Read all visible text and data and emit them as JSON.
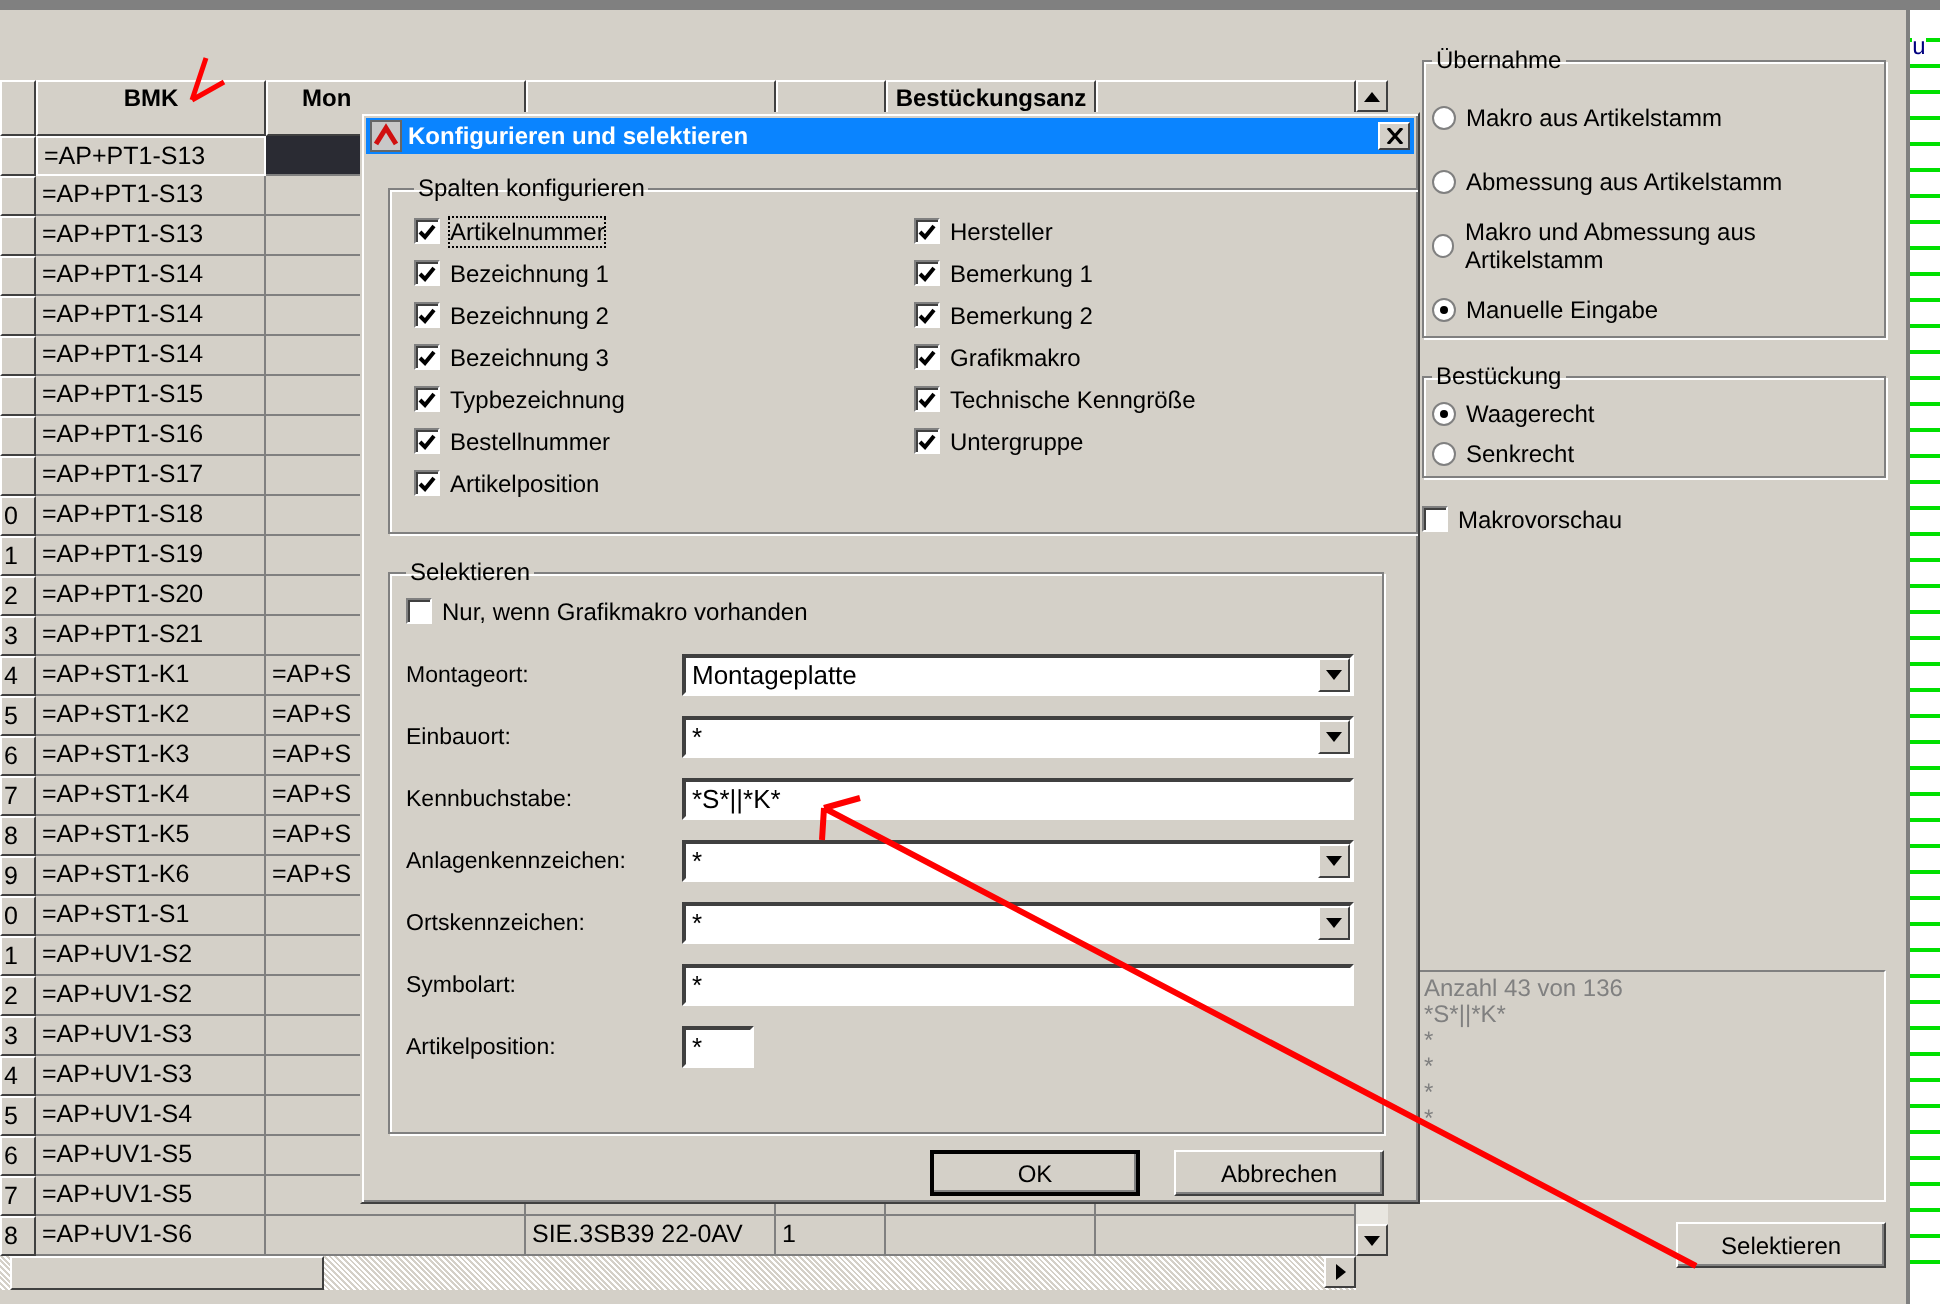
{
  "table": {
    "header": {
      "column_2": "BMK",
      "column_3": "Mon",
      "column_6": "Bestückungsanz"
    },
    "rows": [
      {
        "column_2": "=AP+PT1-S13",
        "selected": true
      },
      {
        "column_2": "=AP+PT1-S13",
        "selected": false
      },
      {
        "column_2": "=AP+PT1-S13",
        "selected": false
      },
      {
        "column_2": "=AP+PT1-S14",
        "selected": false
      },
      {
        "column_2": "=AP+PT1-S14",
        "selected": false
      },
      {
        "column_2": "=AP+PT1-S14",
        "selected": false
      },
      {
        "column_2": "=AP+PT1-S15",
        "selected": false
      },
      {
        "column_2": "=AP+PT1-S16",
        "selected": false
      },
      {
        "column_2": "=AP+PT1-S17",
        "selected": false
      },
      {
        "column_1": "0",
        "column_2": "=AP+PT1-S18",
        "selected": false
      },
      {
        "column_1": "1",
        "column_2": "=AP+PT1-S19",
        "selected": false
      },
      {
        "column_1": "2",
        "column_2": "=AP+PT1-S20",
        "selected": false
      },
      {
        "column_1": "3",
        "column_2": "=AP+PT1-S21",
        "selected": false
      },
      {
        "column_1": "4",
        "column_2": "=AP+ST1-K1",
        "column_3": "=AP+S",
        "selected": false
      },
      {
        "column_1": "5",
        "column_2": "=AP+ST1-K2",
        "column_3": "=AP+S",
        "selected": false
      },
      {
        "column_1": "6",
        "column_2": "=AP+ST1-K3",
        "column_3": "=AP+S",
        "selected": false
      },
      {
        "column_1": "7",
        "column_2": "=AP+ST1-K4",
        "column_3": "=AP+S",
        "selected": false
      },
      {
        "column_1": "8",
        "column_2": "=AP+ST1-K5",
        "column_3": "=AP+S",
        "selected": false
      },
      {
        "column_1": "9",
        "column_2": "=AP+ST1-K6",
        "column_3": "=AP+S",
        "selected": false
      },
      {
        "column_1": "0",
        "column_2": "=AP+ST1-S1",
        "selected": false
      },
      {
        "column_1": "1",
        "column_2": "=AP+UV1-S2",
        "selected": false
      },
      {
        "column_1": "2",
        "column_2": "=AP+UV1-S2",
        "selected": false
      },
      {
        "column_1": "3",
        "column_2": "=AP+UV1-S3",
        "selected": false
      },
      {
        "column_1": "4",
        "column_2": "=AP+UV1-S3",
        "selected": false
      },
      {
        "column_1": "5",
        "column_2": "=AP+UV1-S4",
        "selected": false
      },
      {
        "column_1": "6",
        "column_2": "=AP+UV1-S5",
        "selected": false
      },
      {
        "column_1": "7",
        "column_2": "=AP+UV1-S5",
        "selected": false
      },
      {
        "column_1": "8",
        "column_2": "=AP+UV1-S6",
        "column_4": "SIE.3SB39 22-0AV",
        "column_5": "1",
        "selected": false
      }
    ]
  },
  "side_panel": {
    "uebernahme": {
      "title": "Übernahme",
      "options": [
        {
          "label": "Makro aus Artikelstamm",
          "selected": false
        },
        {
          "label": "Abmessung aus Artikelstamm",
          "selected": false
        },
        {
          "label": "Makro und Abmessung aus Artikelstamm",
          "selected": false
        },
        {
          "label": "Manuelle Eingabe",
          "selected": true
        }
      ]
    },
    "bestueckung": {
      "title": "Bestückung",
      "options": [
        {
          "label": "Waagerecht",
          "selected": true
        },
        {
          "label": "Senkrecht",
          "selected": false
        }
      ]
    },
    "preview": {
      "label": "Makrovorschau",
      "checked": false
    },
    "info_lines": [
      "Anzahl 43 von 136",
      "*S*||*K*",
      "*",
      "*",
      "*",
      "*"
    ],
    "select_button": "Selektieren"
  },
  "right_edge_text": "u",
  "dialog": {
    "title": "Konfigurieren und selektieren",
    "columns_group": {
      "title": "Spalten konfigurieren",
      "items": [
        {
          "label": "Artikelnummer",
          "checked": true,
          "focused": true
        },
        {
          "label": "Bezeichnung 1",
          "checked": true,
          "focused": false
        },
        {
          "label": "Bezeichnung 2",
          "checked": true,
          "focused": false
        },
        {
          "label": "Bezeichnung 3",
          "checked": true,
          "focused": false
        },
        {
          "label": "Typbezeichnung",
          "checked": true,
          "focused": false
        },
        {
          "label": "Bestellnummer",
          "checked": true,
          "focused": false
        },
        {
          "label": "Artikelposition",
          "checked": true,
          "focused": false
        },
        {
          "label": "Hersteller",
          "checked": true,
          "focused": false
        },
        {
          "label": "Bemerkung 1",
          "checked": true,
          "focused": false
        },
        {
          "label": "Bemerkung 2",
          "checked": true,
          "focused": false
        },
        {
          "label": "Grafikmakro",
          "checked": true,
          "focused": false
        },
        {
          "label": "Technische Kenngröße",
          "checked": true,
          "focused": false
        },
        {
          "label": "Untergruppe",
          "checked": true,
          "focused": false
        }
      ]
    },
    "select_group": {
      "title": "Selektieren",
      "macro_only": {
        "label": "Nur, wenn Grafikmakro vorhanden",
        "checked": false
      },
      "fields": [
        {
          "label": "Montageort:",
          "value": "Montageplatte",
          "kind": "combo"
        },
        {
          "label": "Einbauort:",
          "value": "*",
          "kind": "combo"
        },
        {
          "label": "Kennbuchstabe:",
          "value": "*S*||*K*",
          "kind": "text"
        },
        {
          "label": "Anlagenkennzeichen:",
          "value": "*",
          "kind": "combo"
        },
        {
          "label": "Ortskennzeichen:",
          "value": "*",
          "kind": "combo"
        },
        {
          "label": "Symbolart:",
          "value": "*",
          "kind": "text"
        },
        {
          "label": "Artikelposition:",
          "value": "*",
          "kind": "short"
        }
      ]
    },
    "buttons": [
      "OK",
      "Abbrechen"
    ]
  }
}
